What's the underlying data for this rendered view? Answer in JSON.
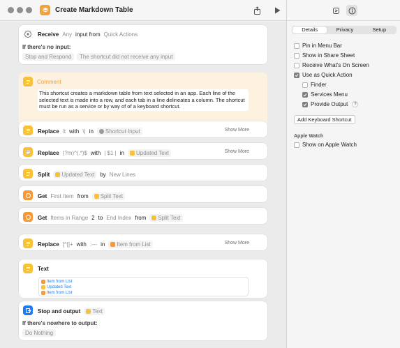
{
  "window": {
    "title": "Create Markdown Table"
  },
  "actions": {
    "receive": {
      "action": "Receive",
      "any": "Any",
      "input_from": "input from",
      "quick_actions": "Quick Actions",
      "no_input_label": "If there's no input:",
      "stop_respond": "Stop and Respond",
      "message": "The shortcut did not receive any input"
    },
    "comment": {
      "title": "Comment",
      "body": "This shortcut creates a markdown table from text selected in an app. Each line of the selected text is made into a row, and each tab in a line delineates a column. The shortcut must be run as a service or by way of of a keyboard shortcut."
    },
    "replace1": {
      "action": "Replace",
      "find": "\\t",
      "with": "with",
      "replacement": "\\|",
      "in": "in",
      "target": "Shortcut Input",
      "show_more": "Show More"
    },
    "replace2": {
      "action": "Replace",
      "find": "(?m)^(.*)$",
      "with": "with",
      "replacement": "| $1 |",
      "in": "in",
      "target": "Updated Text",
      "show_more": "Show More"
    },
    "split": {
      "action": "Split",
      "target": "Updated Text",
      "by": "by",
      "separator": "New Lines"
    },
    "get1": {
      "action": "Get",
      "item": "First Item",
      "from": "from",
      "source": "Split Text"
    },
    "get2": {
      "action": "Get",
      "item": "Items in Range",
      "start": "2",
      "to": "to",
      "end": "End Index",
      "from": "from",
      "source": "Split Text"
    },
    "replace3": {
      "action": "Replace",
      "find": "[^|]+",
      "with": "with",
      "replacement": ":---",
      "in": "in",
      "target": "Item from List",
      "show_more": "Show More"
    },
    "text": {
      "action": "Text",
      "lines": [
        "Item from List",
        "Updated Text",
        "Item from List"
      ]
    },
    "stop_output": {
      "action": "Stop and output",
      "target": "Text",
      "nowhere_label": "If there's nowhere to output:",
      "do_nothing": "Do Nothing"
    }
  },
  "sidebar": {
    "tabs": [
      "Details",
      "Privacy",
      "Setup"
    ],
    "options": {
      "pin_menu_bar": "Pin in Menu Bar",
      "share_sheet": "Show in Share Sheet",
      "receive_onscreen": "Receive What's On Screen",
      "quick_action": "Use as Quick Action",
      "finder": "Finder",
      "services_menu": "Services Menu",
      "provide_output": "Provide Output",
      "help": "?"
    },
    "add_shortcut": "Add Keyboard Shortcut",
    "apple_watch_heading": "Apple Watch",
    "show_watch": "Show on Apple Watch"
  },
  "colors": {
    "accent_yellow": "#f7c23a",
    "accent_orange": "#f59a3a",
    "accent_blue": "#1e7cf2",
    "comment_bg": "#fdf2df"
  }
}
